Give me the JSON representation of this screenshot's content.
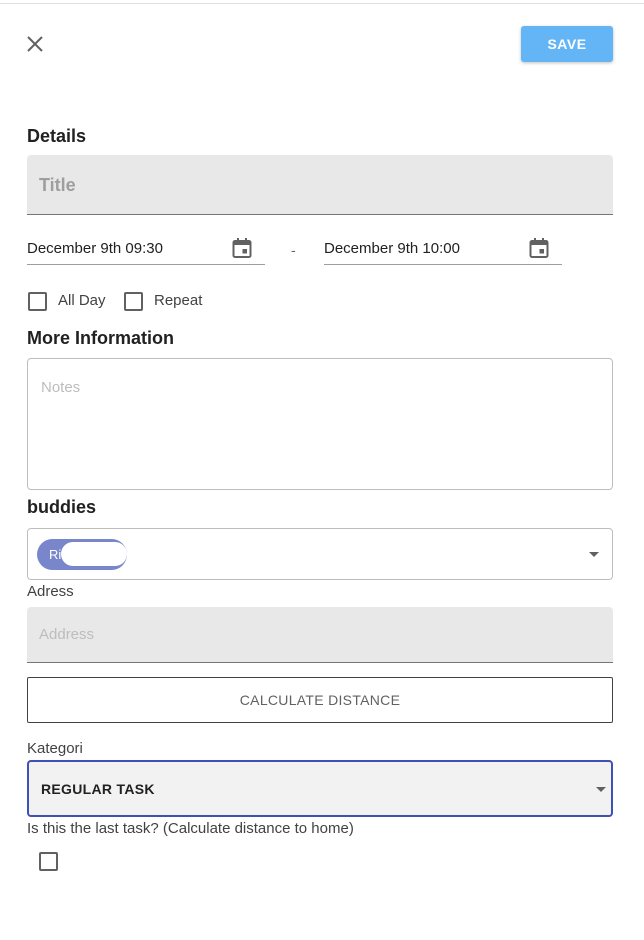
{
  "header": {
    "close_icon": "close-icon",
    "save_label": "SAVE"
  },
  "details": {
    "heading": "Details",
    "title_placeholder": "Title",
    "start_date": "December 9th 09:30",
    "end_date": "December 9th 10:00",
    "date_separator": "-",
    "calendar_icon": "calendar-icon",
    "all_day_label": "All Day",
    "repeat_label": "Repeat"
  },
  "more_info": {
    "heading": "More Information",
    "notes_placeholder": "Notes"
  },
  "buddies": {
    "heading": "buddies",
    "chip_text": "Ri",
    "dropdown_icon": "chevron-down-icon"
  },
  "address": {
    "label": "Adress",
    "placeholder": "Address",
    "calculate_label": "CALCULATE DISTANCE"
  },
  "kategori": {
    "label": "Kategori",
    "selected": "REGULAR TASK"
  },
  "last_task": {
    "label": "Is this the last task? (Calculate distance to home)"
  },
  "colors": {
    "save_button": "#64b5f6",
    "chip": "#7986cb",
    "focus_border": "#3f51b5"
  }
}
